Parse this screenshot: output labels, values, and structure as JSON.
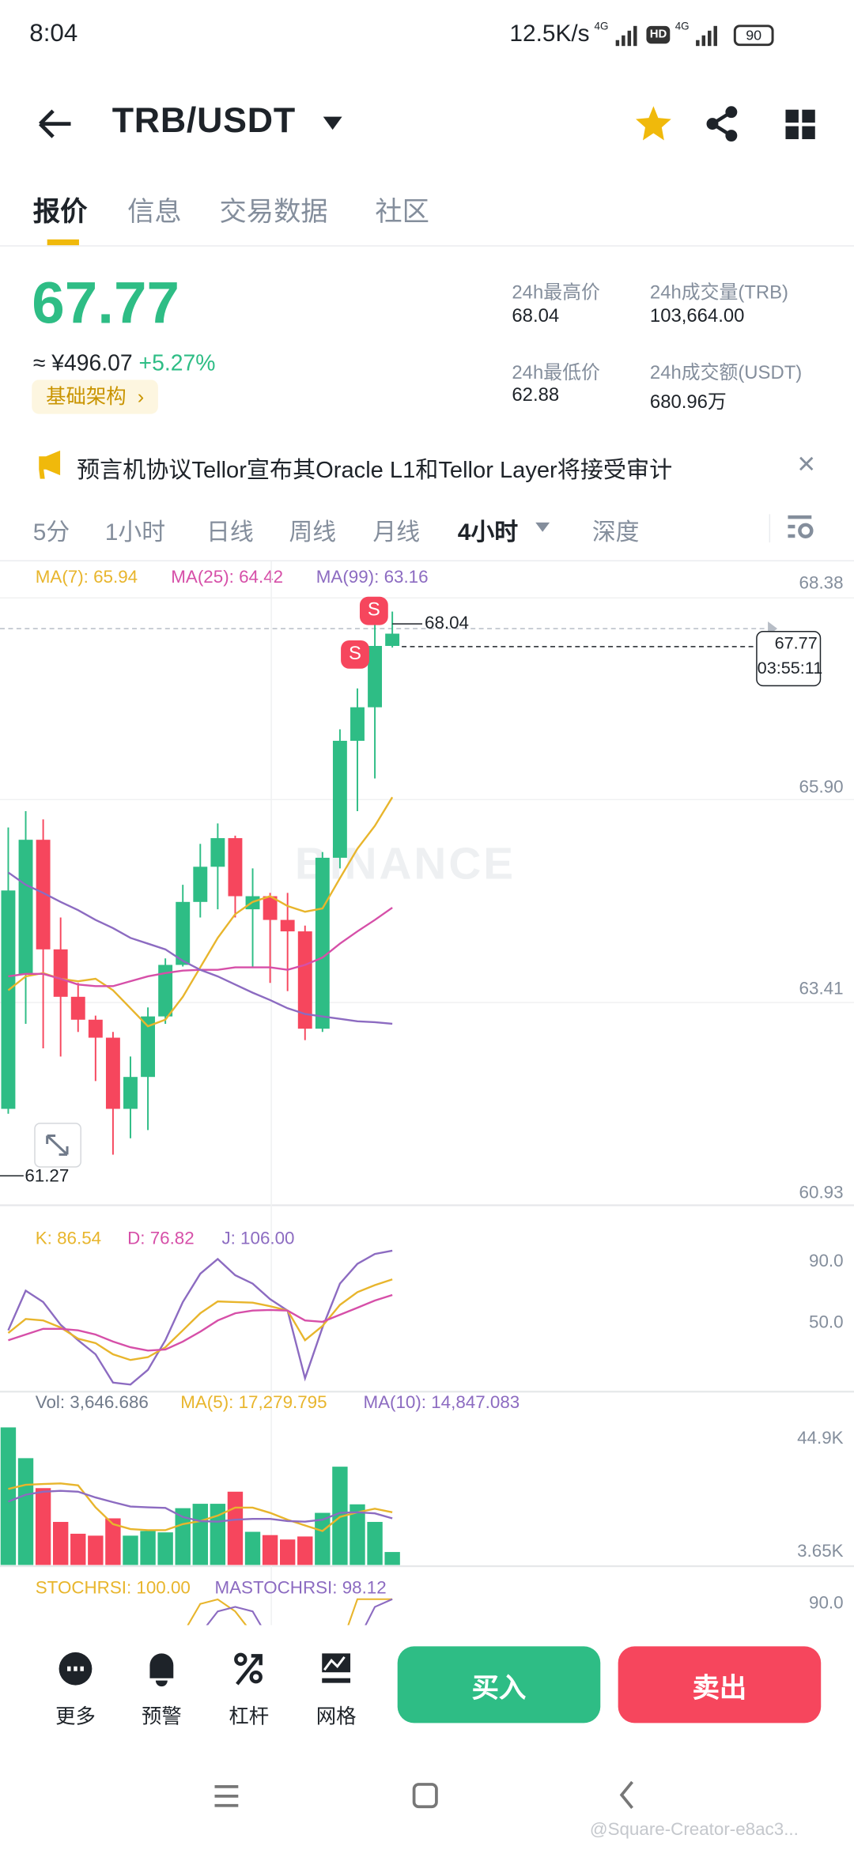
{
  "status_bar": {
    "time": "8:04",
    "net_speed": "12.5K/s",
    "sim1": "4G",
    "hd": "HD",
    "sim2": "4G",
    "battery": "90"
  },
  "header": {
    "pair": "TRB/USDT",
    "favorited": true
  },
  "tabs": [
    {
      "label": "报价",
      "active": true
    },
    {
      "label": "信息"
    },
    {
      "label": "交易数据"
    },
    {
      "label": "社区"
    }
  ],
  "price": {
    "last": "67.77",
    "cny": "≈ ¥496.07",
    "change": "+5.27%",
    "tag": "基础架构",
    "tag_arrow": "›"
  },
  "stats": {
    "high_label": "24h最高价",
    "high": "68.04",
    "low_label": "24h最低价",
    "low": "62.88",
    "vol_label": "24h成交量(TRB)",
    "vol": "103,664.00",
    "amount_label": "24h成交额(USDT)",
    "amount": "680.96万"
  },
  "news": {
    "text": "预言机协议Tellor宣布其Oracle L1和Tellor Layer将接受审计",
    "close": "×"
  },
  "intervals": [
    {
      "label": "5分"
    },
    {
      "label": "1小时"
    },
    {
      "label": "日线"
    },
    {
      "label": "周线"
    },
    {
      "label": "月线"
    },
    {
      "label": "4小时",
      "active": true
    },
    {
      "label": "深度"
    }
  ],
  "colors": {
    "up": "#2ebd85",
    "down": "#f6465d",
    "ma7": "#e8b52c",
    "ma25": "#d64fa8",
    "ma99": "#8c6bc1",
    "accent": "#f0b90b"
  },
  "chart_data": [
    {
      "type": "candlestick",
      "title": "TRB/USDT 4h",
      "legend": {
        "ma7": "MA(7): 65.94",
        "ma25": "MA(25): 64.42",
        "ma99": "MA(99): 63.16"
      },
      "y_ticks": [
        "68.38",
        "65.90",
        "63.41",
        "60.93"
      ],
      "ylim": [
        60.93,
        68.38
      ],
      "high_marker": "68.04",
      "low_marker": "61.27",
      "last_price_box": {
        "price": "67.77",
        "countdown": "03:55:11"
      },
      "signals": [
        "S",
        "S"
      ],
      "watermark": "BINANCE",
      "candles": [
        [
          61.96,
          65.4,
          61.9,
          64.63
        ],
        [
          63.6,
          65.6,
          63.0,
          65.25
        ],
        [
          65.25,
          65.5,
          62.7,
          63.91
        ],
        [
          63.91,
          64.3,
          62.6,
          63.33
        ],
        [
          63.33,
          63.5,
          62.9,
          63.05
        ],
        [
          63.05,
          63.1,
          62.3,
          62.83
        ],
        [
          62.83,
          62.9,
          61.4,
          61.96
        ],
        [
          61.96,
          62.6,
          61.6,
          62.35
        ],
        [
          62.35,
          63.2,
          61.7,
          63.09
        ],
        [
          63.09,
          63.8,
          63.0,
          63.72
        ],
        [
          63.72,
          64.7,
          63.7,
          64.49
        ],
        [
          64.49,
          65.2,
          64.3,
          64.92
        ],
        [
          64.92,
          65.45,
          64.4,
          65.27
        ],
        [
          65.27,
          65.3,
          64.3,
          64.56
        ],
        [
          64.4,
          64.9,
          63.7,
          64.56
        ],
        [
          64.56,
          64.6,
          63.5,
          64.27
        ],
        [
          64.27,
          64.6,
          63.4,
          64.13
        ],
        [
          64.13,
          64.2,
          62.8,
          62.94
        ],
        [
          62.94,
          65.1,
          62.9,
          65.03
        ],
        [
          65.03,
          66.6,
          64.9,
          66.46
        ],
        [
          66.46,
          67.1,
          65.6,
          66.87
        ],
        [
          66.87,
          68.0,
          66.0,
          67.62
        ],
        [
          67.62,
          68.04,
          67.6,
          67.77
        ]
      ],
      "ma7": [
        63.41,
        63.58,
        63.62,
        63.55,
        63.52,
        63.55,
        63.41,
        63.19,
        62.97,
        63.05,
        63.33,
        63.69,
        64.05,
        64.34,
        64.49,
        64.56,
        64.44,
        64.37,
        64.41,
        64.78,
        65.14,
        65.42,
        65.77
      ],
      "ma25": [
        63.58,
        63.61,
        63.61,
        63.55,
        63.48,
        63.46,
        63.46,
        63.52,
        63.58,
        63.62,
        63.65,
        63.66,
        63.66,
        63.69,
        63.69,
        63.69,
        63.66,
        63.72,
        63.81,
        63.98,
        64.13,
        64.27,
        64.42
      ],
      "ma99": [
        64.85,
        64.7,
        64.6,
        64.49,
        64.39,
        64.27,
        64.17,
        64.05,
        63.98,
        63.91,
        63.77,
        63.66,
        63.58,
        63.48,
        63.38,
        63.29,
        63.19,
        63.12,
        63.09,
        63.06,
        63.03,
        63.02,
        63.0
      ]
    },
    {
      "type": "line",
      "title": "KDJ",
      "legend": {
        "k": "K: 86.54",
        "d": "D: 76.82",
        "j": "J: 106.00"
      },
      "y_ticks": [
        "90.0",
        "50.0"
      ],
      "k": [
        42.5,
        51.9,
        50.9,
        46.2,
        38.7,
        35.8,
        28.3,
        24.5,
        26.4,
        33.0,
        44.3,
        55.7,
        63.6,
        63.2,
        62.8,
        60.4,
        57.5,
        37.7,
        47.2,
        61.3,
        69.8,
        74.5,
        78.3
      ],
      "d": [
        37.7,
        41.5,
        45.3,
        45.3,
        44.3,
        41.5,
        36.8,
        33.0,
        30.8,
        31.5,
        36.8,
        43.4,
        50.9,
        55.7,
        57.5,
        57.9,
        57.5,
        50.9,
        50.0,
        54.7,
        59.4,
        64.2,
        67.9
      ],
      "j": [
        44.3,
        70.8,
        63.2,
        48.0,
        37.7,
        28.3,
        9.4,
        8.1,
        17.9,
        37.7,
        63.2,
        82.1,
        91.9,
        81.1,
        75.5,
        65.1,
        57.5,
        12.3,
        46.2,
        75.5,
        88.7,
        95.3,
        97.5
      ]
    },
    {
      "type": "bar",
      "title": "Volume",
      "legend": {
        "vol": "Vol: 3,646.686",
        "ma5": "MA(5): 17,279.795",
        "ma10": "MA(10): 14,847.083"
      },
      "y_ticks": [
        "44.9K",
        "3.65K"
      ],
      "unit": "K",
      "values": [
        49.0,
        37.8,
        26.9,
        14.6,
        10.3,
        9.6,
        15.9,
        9.6,
        11.3,
        10.8,
        19.6,
        21.2,
        21.2,
        25.6,
        11.0,
        9.8,
        8.2,
        9.3,
        17.9,
        34.7,
        21.0,
        14.6,
        3.65
      ],
      "ma5": [
        26.6,
        28.1,
        28.4,
        28.6,
        27.9,
        19.9,
        13.8,
        12.0,
        11.6,
        11.6,
        13.8,
        14.9,
        16.9,
        19.8,
        19.8,
        17.9,
        15.4,
        13.3,
        11.3,
        16.4,
        18.1,
        19.4,
        18.1
      ],
      "ma10": [
        22.0,
        24.5,
        25.6,
        25.9,
        25.6,
        23.5,
        21.8,
        20.2,
        19.9,
        19.7,
        16.4,
        14.9,
        14.7,
        15.4,
        15.7,
        15.7,
        14.9,
        14.7,
        15.4,
        17.9,
        18.1,
        17.7,
        15.9
      ]
    },
    {
      "type": "line",
      "title": "StochRSI",
      "legend": {
        "stochrsi": "STOCHRSI: 100.00",
        "mastochrsi": "MASTOCHRSI: 98.12"
      },
      "y_ticks": [
        "90.0"
      ],
      "stochrsi": [
        70,
        60,
        50,
        40,
        30,
        20,
        10,
        5,
        15,
        40,
        70,
        90,
        93,
        85,
        70,
        50,
        30,
        10,
        20,
        60,
        95,
        100,
        100
      ],
      "mastochrsi": [
        60,
        55,
        50,
        45,
        35,
        25,
        15,
        10,
        12,
        25,
        45,
        70,
        85,
        88,
        85,
        65,
        45,
        25,
        20,
        35,
        65,
        88,
        98
      ]
    }
  ],
  "bottom_bar": {
    "more": "更多",
    "alert": "预警",
    "margin": "杠杆",
    "grid": "网格",
    "buy": "买入",
    "sell": "卖出"
  },
  "watermark": "@Square-Creator-e8ac3..."
}
